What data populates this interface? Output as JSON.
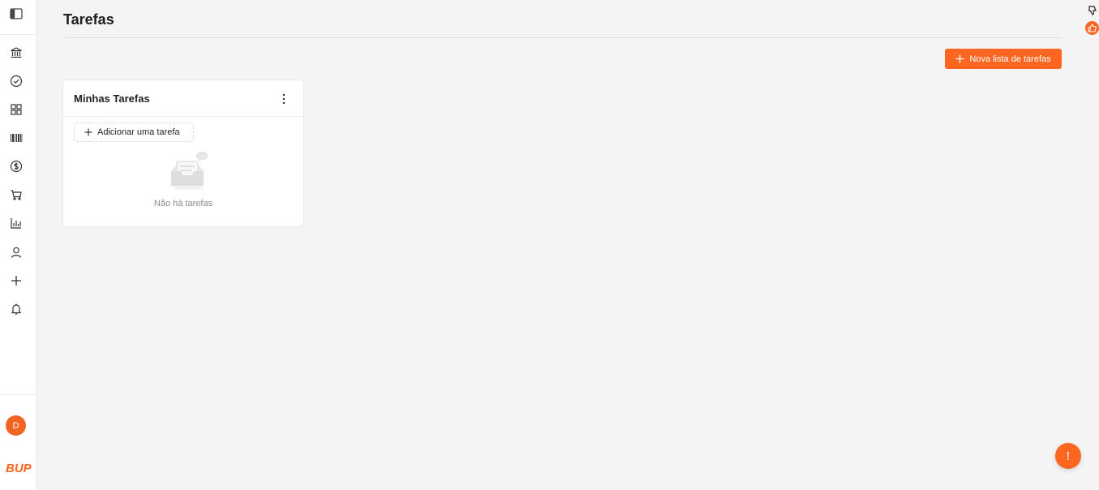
{
  "page": {
    "title": "Tarefas"
  },
  "header": {
    "new_list_label": "Nova lista de tarefas"
  },
  "sidebar": {
    "items": [
      {
        "icon": "bank-icon"
      },
      {
        "icon": "check-circle-icon"
      },
      {
        "icon": "grid-icon"
      },
      {
        "icon": "barcode-icon"
      },
      {
        "icon": "dollar-icon"
      },
      {
        "icon": "cart-icon"
      },
      {
        "icon": "bar-chart-icon"
      },
      {
        "icon": "user-icon"
      },
      {
        "icon": "plus-icon"
      },
      {
        "icon": "bell-icon"
      }
    ],
    "avatar_initial": "D",
    "logo_text": "BUP"
  },
  "task_list": {
    "title": "Minhas Tarefas",
    "add_label": "Adicionar uma tarefa",
    "empty_text": "Não há tarefas"
  },
  "help": {
    "label": "!"
  },
  "colors": {
    "accent": "#fc6621",
    "background": "#f4f4f4",
    "card": "#ffffff"
  }
}
